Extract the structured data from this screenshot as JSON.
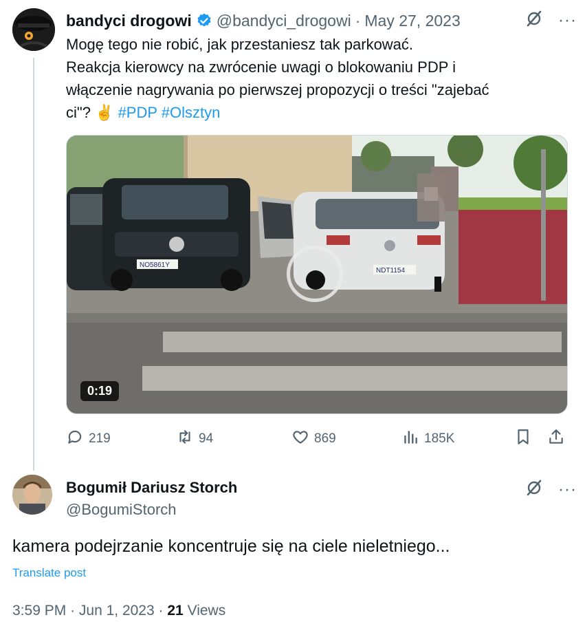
{
  "tweet": {
    "author_name": "bandyci drogowi",
    "handle": "@bandyci_drogowi",
    "separator": "·",
    "date": "May 27, 2023",
    "line1": "Mogę tego nie robić, jak przestaniesz tak parkować.",
    "line2": "Reakcja kierowcy na zwrócenie uwagi o blokowaniu PDP i",
    "line3": "włączenie nagrywania po pierwszej propozycji o treści \"zajebać",
    "line4_start": "ci\"? ✌️",
    "hashtags": [
      "#PDP",
      "#Olsztyn"
    ],
    "video_duration": "0:19",
    "plate_left": "NO5861Y",
    "plate_right": "NDT1154",
    "more_label": "···",
    "icons": {
      "verified": "verified-badge-icon",
      "grok": "grok-icon",
      "reply": "reply-icon",
      "retweet": "retweet-icon",
      "like": "heart-icon",
      "views": "views-chart-icon",
      "bookmark": "bookmark-icon",
      "share": "share-icon"
    },
    "stats": {
      "replies": "219",
      "retweets": "94",
      "likes": "869",
      "views": "185K"
    }
  },
  "reply": {
    "author_name": "Bogumił Dariusz Storch",
    "handle": "@BogumiStorch",
    "more_label": "···",
    "text": "kamera podejrzanie koncentruje się na ciele nieletniego...",
    "translate_label": "Translate post",
    "time": "3:59 PM",
    "separator": "·",
    "date": "Jun 1, 2023",
    "views_count": "21",
    "views_label": "Views"
  },
  "colors": {
    "accent": "#1d9bf0",
    "text": "#0f1419",
    "muted": "#536471",
    "verified": "#1d9bf0"
  }
}
